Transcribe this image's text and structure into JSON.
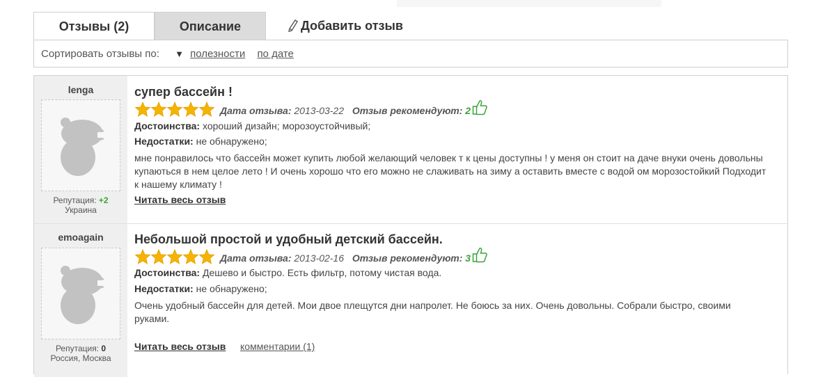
{
  "tabs": {
    "reviews": "Отзывы (2)",
    "description": "Описание",
    "add_review": "Добавить отзыв"
  },
  "sort": {
    "label": "Сортировать отзывы по:",
    "by_usefulness": "полезности",
    "by_date": "по дате"
  },
  "labels": {
    "date": "Дата отзыва:",
    "recommend": "Отзыв рекомендуют:",
    "pros": "Достоинства:",
    "cons": "Недостатки:",
    "reputation": "Репутация:",
    "read_full": "Читать весь отзыв"
  },
  "reviews": [
    {
      "user": "lenga",
      "reputation": "+2",
      "location": "Украина",
      "title": "супер бассейн !",
      "rating": 5,
      "date": "2013-03-22",
      "recommend": "2",
      "pros": "хороший дизайн; морозоустойчивый;",
      "cons": "не обнаружено;",
      "text": "мне понравилось что бассейн может купить любой желающий человек т к цены доступны ! у меня он стоит на даче внуки очень довольны купаються в нем целое лето ! И очень хорошо что его можно не слаживать на зиму а оставить вместе с водой ом морозостойкий Подходит к нашему климату !"
    },
    {
      "user": "emoagain",
      "reputation": "0",
      "location": "Россия, Москва",
      "title": "Небольшой простой и удобный детский бассейн.",
      "rating": 5,
      "date": "2013-02-16",
      "recommend": "3",
      "pros": "Дешево и быстро. Есть фильтр, потому чистая вода.",
      "cons": "не обнаружено;",
      "text": "Очень удобный бассейн для детей. Мои двое плещутся дни напролет. Не боюсь за них. Очень довольны. Собрали быстро, своими руками.",
      "comments": "комментарии (1)"
    }
  ],
  "colors": {
    "star": "#f5b400",
    "accent_green": "#3aa33a",
    "tab_inactive": "#dcdcdc",
    "sidebar": "#efefef"
  },
  "icons": {
    "add": "pencil-icon",
    "recommend": "thumbs-up-icon",
    "rating": "star-icon",
    "avatar": "avatar-placeholder-icon",
    "sort": "triangle-down-icon"
  }
}
